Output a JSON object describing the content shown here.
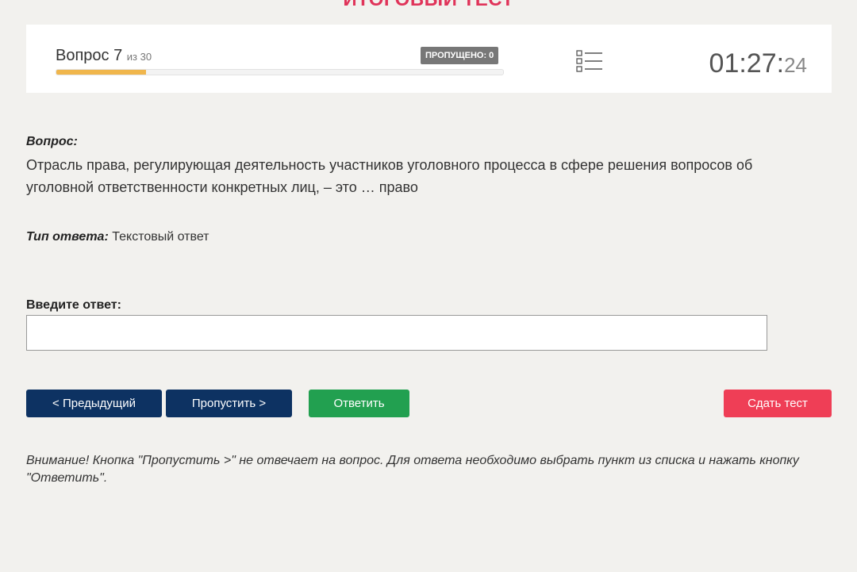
{
  "page": {
    "title": "ИТОГОВЫЙ ТЕСТ"
  },
  "status": {
    "question_label": "Вопрос 7",
    "question_of": "из 30",
    "question_current": 7,
    "question_total": 30,
    "skipped_label": "ПРОПУЩЕНО: 0",
    "progress_fraction": 0.2,
    "progress_color": "#f0b64c",
    "question_list_icon": "list-icon",
    "timer_main": "01:27:",
    "timer_seconds": "24"
  },
  "question": {
    "label": "Вопрос:",
    "text": "Отрасль права, регулирующая деятельность участников уголовного процесса в сфере решения вопросов об уголовной ответственности конкретных лиц, – это … право"
  },
  "answer_type": {
    "label": "Тип ответа:",
    "value": "Текстовый ответ"
  },
  "answer_input": {
    "label": "Введите ответ:",
    "value": "",
    "placeholder": ""
  },
  "buttons": {
    "prev": "< Предыдущий",
    "skip": "Пропустить >",
    "answer": "Ответить",
    "submit": "Сдать тест"
  },
  "colors": {
    "title": "#e0345a",
    "nav_button": "#0d3262",
    "answer_button": "#22a050",
    "submit_button": "#ef3e56",
    "badge": "#777777",
    "background": "#f2f1ee"
  },
  "warning": "Внимание! Кнопка \"Пропустить >\" не отвечает на вопрос. Для ответа необходимо выбрать пункт из списка и нажать кнопку \"Ответить\"."
}
